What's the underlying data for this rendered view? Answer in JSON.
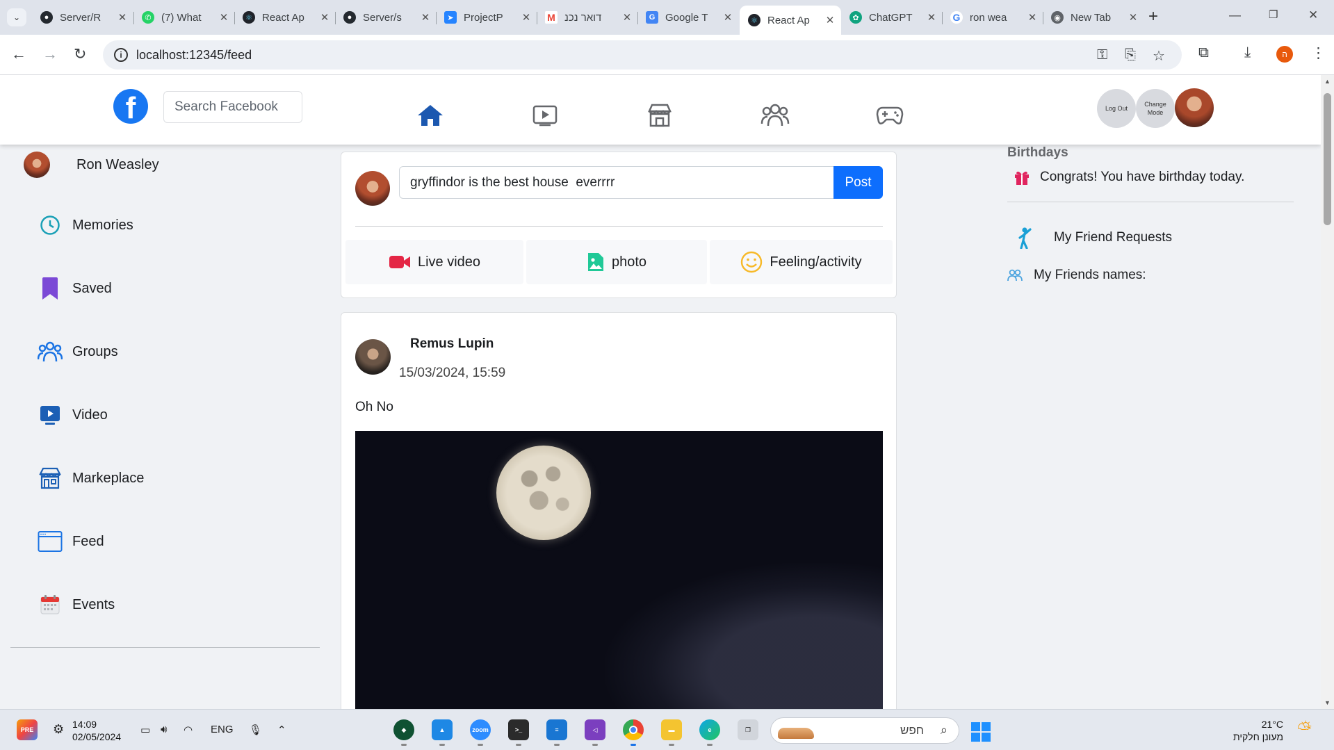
{
  "browser": {
    "tabs": [
      {
        "title": "Server/R",
        "icon": "github-icon"
      },
      {
        "title": "(7) What",
        "icon": "whatsapp-icon"
      },
      {
        "title": "React Ap",
        "icon": "react-icon"
      },
      {
        "title": "Server/s",
        "icon": "github-icon"
      },
      {
        "title": "ProjectP",
        "icon": "jira-icon"
      },
      {
        "title": "דואר נכנ",
        "icon": "gmail-icon"
      },
      {
        "title": "Google T",
        "icon": "google-translate-icon"
      },
      {
        "title": "React Ap",
        "icon": "react-icon",
        "active": true
      },
      {
        "title": "ChatGPT",
        "icon": "chatgpt-icon"
      },
      {
        "title": "ron wea",
        "icon": "google-icon"
      },
      {
        "title": "New Tab",
        "icon": "chrome-icon"
      }
    ],
    "url": "localhost:12345/feed",
    "profile_initial": "ה"
  },
  "header": {
    "logo_letter": "f",
    "search_placeholder": "Search Facebook",
    "logout_label": "Log Out",
    "change_mode_label": "Change Mode"
  },
  "user": {
    "name": "Ron Weasley"
  },
  "sidebar": {
    "items": [
      {
        "label": "Memories",
        "icon": "clock-icon"
      },
      {
        "label": "Saved",
        "icon": "bookmark-icon"
      },
      {
        "label": "Groups",
        "icon": "groups-icon"
      },
      {
        "label": "Video",
        "icon": "video-icon"
      },
      {
        "label": "Markeplace",
        "icon": "store-icon"
      },
      {
        "label": "Feed",
        "icon": "feed-icon"
      },
      {
        "label": "Events",
        "icon": "calendar-icon"
      }
    ]
  },
  "composer": {
    "input_value": "gryffindor is the best house  everrrr",
    "post_label": "Post",
    "actions": [
      {
        "label": "Live video",
        "icon": "live-video-icon",
        "color": "#e42645"
      },
      {
        "label": "photo",
        "icon": "photo-icon",
        "color": "#20c997"
      },
      {
        "label": "Feeling/activity",
        "icon": "smile-icon",
        "color": "#f7b928"
      }
    ]
  },
  "post": {
    "author": "Remus Lupin",
    "date": "15/03/2024, 15:59",
    "text": "Oh No",
    "image_desc": "full-moon-night-sky"
  },
  "right": {
    "birthdays_title": "Birthdays",
    "birthday_text": "Congrats! You have birthday today.",
    "friend_requests": "My Friend Requests",
    "friends_names": "My Friends names:"
  },
  "taskbar": {
    "time": "14:09",
    "date": "02/05/2024",
    "lang": "ENG",
    "search_placeholder": "חפש",
    "temperature": "21°C",
    "weather": "מעונן חלקית"
  },
  "colors": {
    "facebook_blue": "#1877f2",
    "post_button": "#0d6efd",
    "page_bg": "#f0f2f5"
  }
}
